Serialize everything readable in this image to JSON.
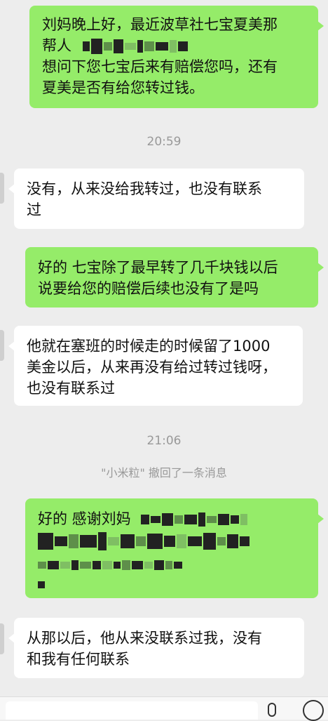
{
  "messages": [
    {
      "lines": [
        "刘妈晚上好，最近波草社七宝夏美那",
        "帮人",
        "想问下您七宝后来有赔偿您吗，还有",
        "夏美是否有给您转过钱。"
      ]
    },
    {
      "time": "20:59"
    },
    {
      "lines": [
        "没有，从来没给我转过，也没有联系",
        "过"
      ]
    },
    {
      "lines": [
        "好的 七宝除了最早转了几千块钱以后",
        "说要给您的赔偿后续也没有了是吗"
      ]
    },
    {
      "lines": [
        "他就在塞班的时候走的时候留了1000",
        "美金以后，从来再没有给过转过钱呀，",
        "也没有联系过"
      ]
    },
    {
      "time": "21:06"
    },
    {
      "system": "\"小米粒\" 撤回了一条消息"
    },
    {
      "lines": [
        "好的 感谢刘妈"
      ]
    },
    {
      "lines": [
        "从那以后，他从来没联系过我，没有",
        "和我有任何联系"
      ]
    }
  ],
  "colors": {
    "sent": "#95ec69",
    "received": "#ffffff",
    "background": "#ededed",
    "meta": "#999999"
  },
  "icons": {
    "voice": "mic-icon",
    "emoji": "emoji-icon"
  }
}
